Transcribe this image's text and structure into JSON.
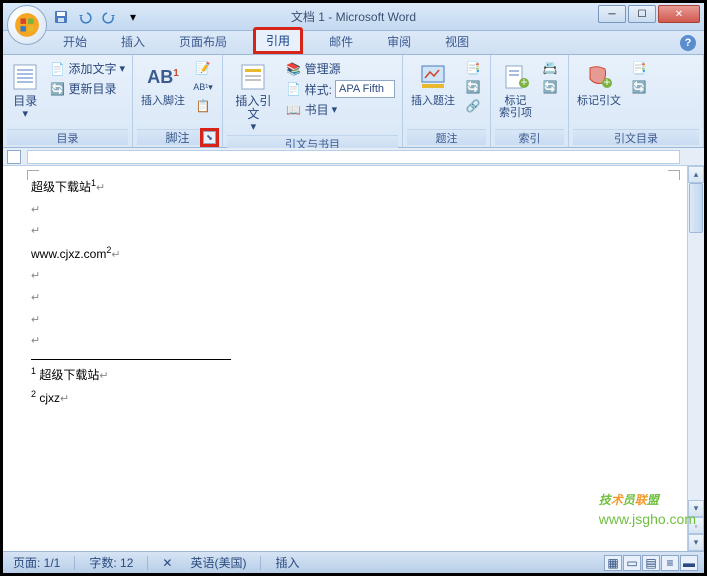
{
  "title": "文档 1 - Microsoft Word",
  "qat": {
    "save": "保存",
    "undo": "撤销",
    "redo": "重做"
  },
  "tabs": [
    "开始",
    "插入",
    "页面布局",
    "引用",
    "邮件",
    "审阅",
    "视图"
  ],
  "active_tab": "引用",
  "ribbon": {
    "toc": {
      "label": "目录",
      "btn": "目录",
      "add_text": "添加文字",
      "update": "更新目录"
    },
    "footnote": {
      "label": "脚注",
      "insert": "插入脚注",
      "ab": "AB"
    },
    "citation": {
      "label": "引文与书目",
      "insert": "插入引文",
      "manage": "管理源",
      "style_lbl": "样式:",
      "style_val": "APA Fifth",
      "biblio": "书目"
    },
    "caption": {
      "label": "题注",
      "insert": "插入题注"
    },
    "index": {
      "label": "索引",
      "mark": "标记\n索引项"
    },
    "toa": {
      "label": "引文目录",
      "mark": "标记引文"
    }
  },
  "document": {
    "line1": "超级下载站",
    "sup1": "1",
    "line2": "www.cjxz.com",
    "sup2": "2",
    "fn1_num": "1",
    "fn1_text": "超级下载站",
    "fn2_num": "2",
    "fn2_text": "cjxz"
  },
  "statusbar": {
    "page": "页面: 1/1",
    "words": "字数: 12",
    "lang": "英语(美国)",
    "mode": "插入"
  },
  "watermark": {
    "main": "技术员联盟",
    "sub": "www.jsgho.com"
  }
}
